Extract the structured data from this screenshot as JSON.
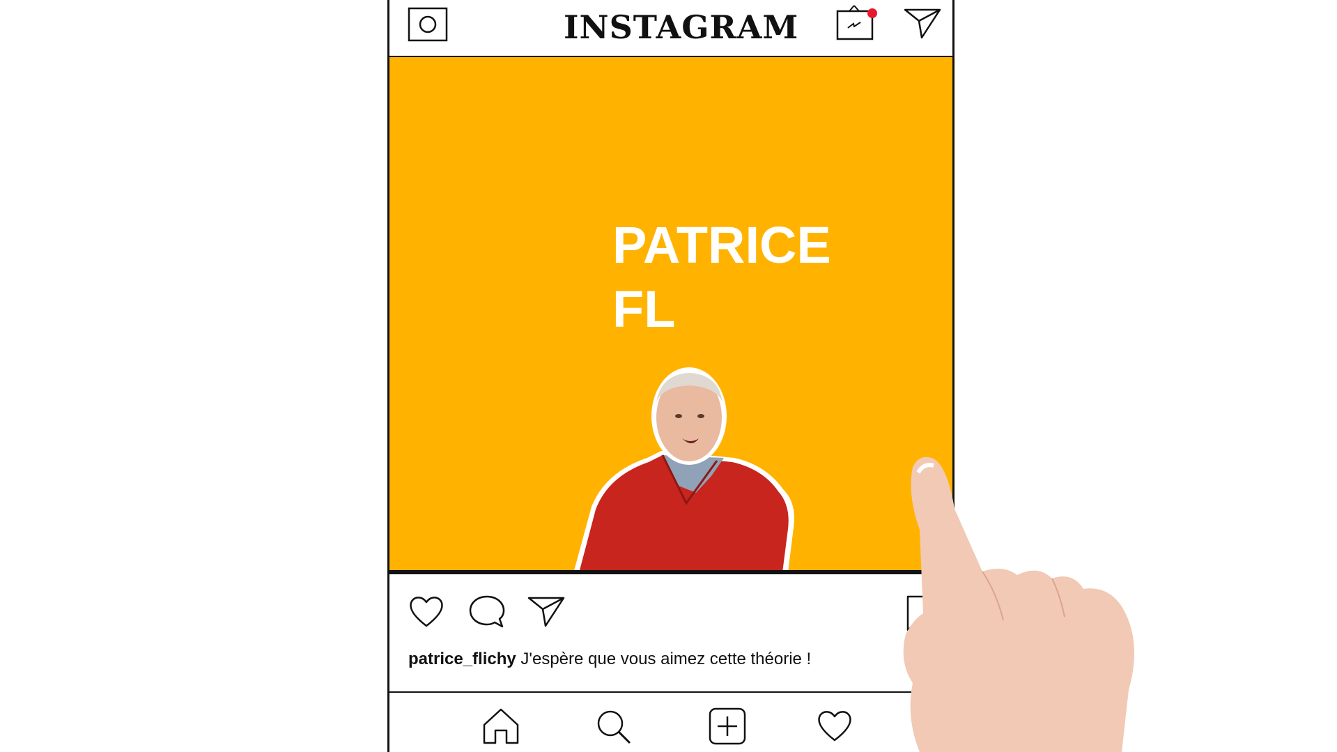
{
  "app": {
    "title": "INSTAGRAM"
  },
  "header": {
    "icons": [
      "camera-icon",
      "igtv-icon",
      "direct-message-icon"
    ],
    "igtv_badge_color": "#E8192C"
  },
  "post": {
    "background_color": "#FFB300",
    "headline_line1": "PATRICE",
    "headline_line2": "FL",
    "actions": [
      "like-icon",
      "comment-icon",
      "share-icon",
      "bookmark-icon"
    ],
    "caption": {
      "username": "patrice_flichy",
      "text": " J'espère que vous aimez cette théorie !"
    }
  },
  "bottom_nav": {
    "icons": [
      "home-icon",
      "search-icon",
      "add-post-icon",
      "activity-icon"
    ]
  }
}
